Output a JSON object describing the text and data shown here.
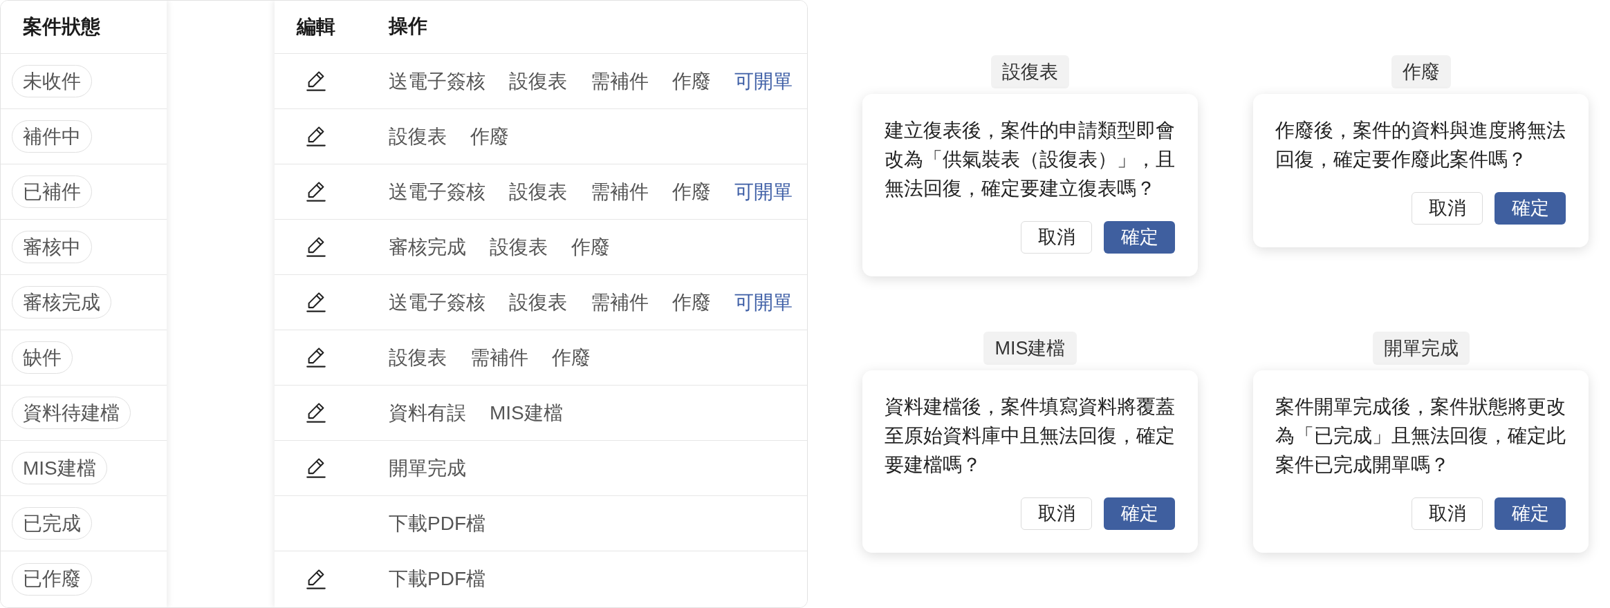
{
  "table": {
    "columns": [
      "案件狀態",
      "編輯",
      "操作"
    ],
    "rows": [
      {
        "status": "未收件",
        "editable": true,
        "actions": [
          {
            "label": "送電子簽核",
            "kind": "plain"
          },
          {
            "label": "設復表",
            "kind": "plain"
          },
          {
            "label": "需補件",
            "kind": "plain"
          },
          {
            "label": "作廢",
            "kind": "plain"
          },
          {
            "label": "可開單",
            "kind": "link"
          }
        ]
      },
      {
        "status": "補件中",
        "editable": true,
        "actions": [
          {
            "label": "設復表",
            "kind": "plain"
          },
          {
            "label": "作廢",
            "kind": "plain"
          }
        ]
      },
      {
        "status": "已補件",
        "editable": true,
        "actions": [
          {
            "label": "送電子簽核",
            "kind": "plain"
          },
          {
            "label": "設復表",
            "kind": "plain"
          },
          {
            "label": "需補件",
            "kind": "plain"
          },
          {
            "label": "作廢",
            "kind": "plain"
          },
          {
            "label": "可開單",
            "kind": "link"
          }
        ]
      },
      {
        "status": "審核中",
        "editable": true,
        "actions": [
          {
            "label": "審核完成",
            "kind": "plain"
          },
          {
            "label": "設復表",
            "kind": "plain"
          },
          {
            "label": "作廢",
            "kind": "plain"
          }
        ]
      },
      {
        "status": "審核完成",
        "editable": true,
        "actions": [
          {
            "label": "送電子簽核",
            "kind": "plain"
          },
          {
            "label": "設復表",
            "kind": "plain"
          },
          {
            "label": "需補件",
            "kind": "plain"
          },
          {
            "label": "作廢",
            "kind": "plain"
          },
          {
            "label": "可開單",
            "kind": "link"
          }
        ]
      },
      {
        "status": "缺件",
        "editable": true,
        "actions": [
          {
            "label": "設復表",
            "kind": "plain"
          },
          {
            "label": "需補件",
            "kind": "plain"
          },
          {
            "label": "作廢",
            "kind": "plain"
          }
        ]
      },
      {
        "status": "資料待建檔",
        "editable": true,
        "actions": [
          {
            "label": "資料有誤",
            "kind": "plain"
          },
          {
            "label": "MIS建檔",
            "kind": "plain"
          }
        ]
      },
      {
        "status": "MIS建檔",
        "editable": true,
        "actions": [
          {
            "label": "開單完成",
            "kind": "plain"
          }
        ]
      },
      {
        "status": "已完成",
        "editable": false,
        "actions": [
          {
            "label": "下載PDF檔",
            "kind": "plain"
          }
        ]
      },
      {
        "status": "已作廢",
        "editable": true,
        "actions": [
          {
            "label": "下載PDF檔",
            "kind": "plain"
          }
        ]
      }
    ]
  },
  "dialogs": [
    {
      "tag": "設復表",
      "message": "建立復表後，案件的申請類型即會改為「供氣裝表（設復表）」，且無法回復，確定要建立復表嗎？",
      "buttons": [
        {
          "label": "取消",
          "kind": "secondary"
        },
        {
          "label": "確定",
          "kind": "primary"
        }
      ]
    },
    {
      "tag": "作廢",
      "message": "作廢後，案件的資料與進度將無法回復，確定要作廢此案件嗎？",
      "buttons": [
        {
          "label": "取消",
          "kind": "secondary"
        },
        {
          "label": "確定",
          "kind": "primary"
        }
      ]
    },
    {
      "tag": "MIS建檔",
      "message": "資料建檔後，案件填寫資料將覆蓋至原始資料庫中且無法回復，確定要建檔嗎？",
      "buttons": [
        {
          "label": "取消",
          "kind": "secondary"
        },
        {
          "label": "確定",
          "kind": "primary"
        }
      ]
    },
    {
      "tag": "開單完成",
      "message": "案件開單完成後，案件狀態將更改為「已完成」且無法回復，確定此案件已完成開單嗎？",
      "buttons": [
        {
          "label": "取消",
          "kind": "secondary"
        },
        {
          "label": "確定",
          "kind": "primary"
        }
      ]
    }
  ]
}
